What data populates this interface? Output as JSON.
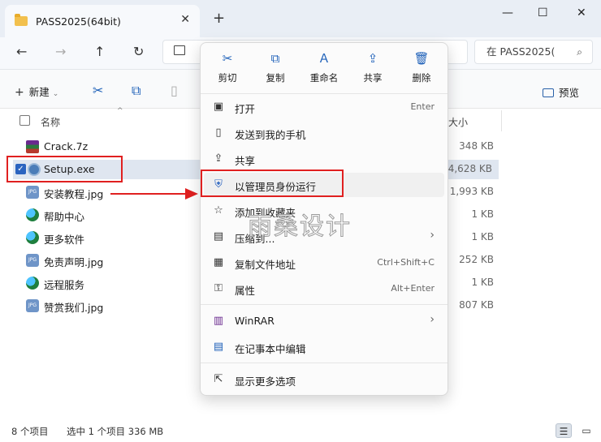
{
  "window": {
    "tab_title": "PASS2025(64bit)",
    "close_tab": "✕",
    "new_tab": "+",
    "minimize": "—",
    "maximize": "☐",
    "close": "✕"
  },
  "nav": {
    "back": "←",
    "forward": "→",
    "up": "↑",
    "refresh": "↻",
    "search_placeholder": "在 PASS2025(",
    "search_icon": "⌕"
  },
  "toolbar": {
    "new_label": "新建",
    "new_icon": "+",
    "new_caret": "⌄",
    "cut_icon": "✂",
    "copy_icon": "⧉",
    "preview_label": "预览"
  },
  "list": {
    "header_name": "名称",
    "header_size": "大小",
    "sort_caret": "^",
    "files": [
      {
        "name": "Crack.7z",
        "size": "348 KB",
        "icon": "winrar-icon"
      },
      {
        "name": "Setup.exe",
        "size": "1,144,628 KB",
        "icon": "setup-exe-icon",
        "selected": true
      },
      {
        "name": "安装教程.jpg",
        "size": "1,993 KB",
        "icon": "jpg-icon"
      },
      {
        "name": "帮助中心",
        "size": "1 KB",
        "icon": "web-shortcut-icon"
      },
      {
        "name": "更多软件",
        "size": "1 KB",
        "icon": "web-shortcut-icon"
      },
      {
        "name": "免责声明.jpg",
        "size": "252 KB",
        "icon": "jpg-icon"
      },
      {
        "name": "远程服务",
        "size": "1 KB",
        "icon": "web-shortcut-icon"
      },
      {
        "name": "赞赏我们.jpg",
        "size": "807 KB",
        "icon": "jpg-icon"
      }
    ],
    "checkmark": "✓"
  },
  "context_menu": {
    "quick_actions": [
      {
        "label": "剪切",
        "icon": "✂"
      },
      {
        "label": "复制",
        "icon": "⧉"
      },
      {
        "label": "重命名",
        "icon": "Ａ"
      },
      {
        "label": "共享",
        "icon": "⇪"
      },
      {
        "label": "删除",
        "icon": "🗑"
      }
    ],
    "items": [
      {
        "label": "打开",
        "shortcut": "Enter",
        "icon": "▣"
      },
      {
        "label": "发送到我的手机",
        "shortcut": "",
        "icon": "▯"
      },
      {
        "label": "共享",
        "shortcut": "",
        "icon": "⇪"
      },
      {
        "label": "以管理员身份运行",
        "shortcut": "",
        "icon": "⛨"
      },
      {
        "label": "添加到收藏夹",
        "shortcut": "",
        "icon": "☆"
      },
      {
        "label": "压缩到...",
        "shortcut": "",
        "icon": "▤",
        "submenu": "›"
      },
      {
        "label": "复制文件地址",
        "shortcut": "Ctrl+Shift+C",
        "icon": "▦"
      },
      {
        "label": "属性",
        "shortcut": "Alt+Enter",
        "icon": "⚿"
      },
      {
        "label": "WinRAR",
        "shortcut": "",
        "icon": "▥",
        "submenu": "›"
      },
      {
        "label": "在记事本中编辑",
        "shortcut": "",
        "icon": "▤"
      },
      {
        "label": "显示更多选项",
        "shortcut": "",
        "icon": "⇱"
      }
    ]
  },
  "watermark": "雨桑设计",
  "status": {
    "count": "8 个项目",
    "selection": "选中 1 个项目  336 MB",
    "view_details_icon": "☰",
    "view_tiles_icon": "▭"
  },
  "colors": {
    "accent": "#2b64c0",
    "annotation": "#e02020",
    "selection_bg": "#dfe6f0"
  }
}
